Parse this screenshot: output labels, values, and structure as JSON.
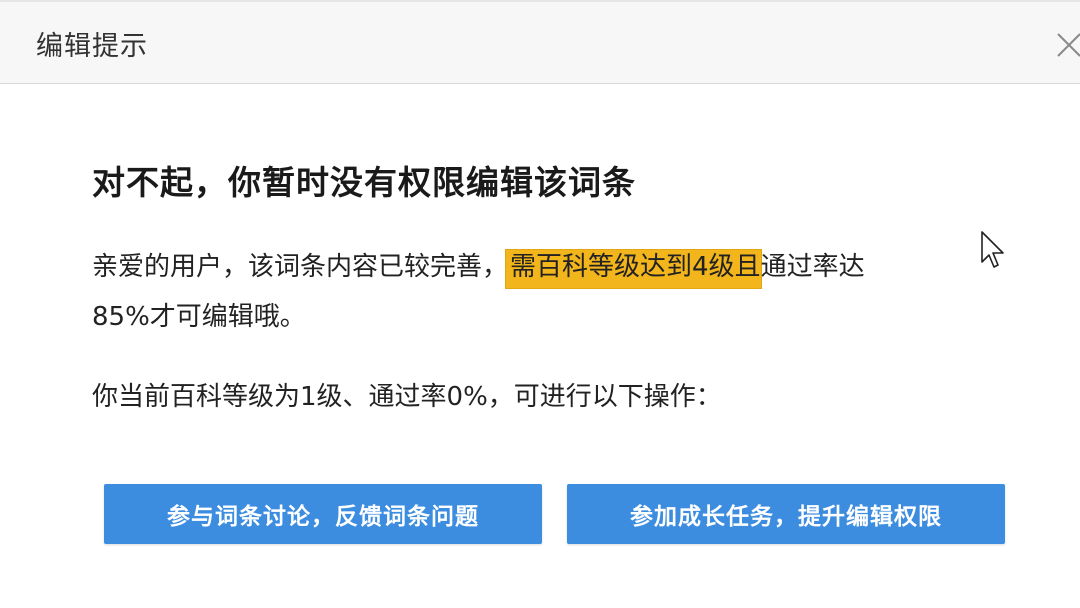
{
  "dialog": {
    "title": "编辑提示",
    "close_icon": "close-icon"
  },
  "content": {
    "heading": "对不起，你暂时没有权限编辑该词条",
    "message_part1": "亲爱的用户，该词条内容已较完善，",
    "message_highlight": "需百科等级达到4级且",
    "message_part2": "通过率达",
    "message_line2": "85%才可编辑哦。",
    "status": "你当前百科等级为1级、通过率0%，可进行以下操作："
  },
  "actions": {
    "discuss_label": "参与词条讨论，反馈词条问题",
    "task_label": "参加成长任务，提升编辑权限"
  },
  "colors": {
    "button_bg": "#3c8de0",
    "highlight": "#f2b51c",
    "header_bg": "#f7f7f7"
  }
}
